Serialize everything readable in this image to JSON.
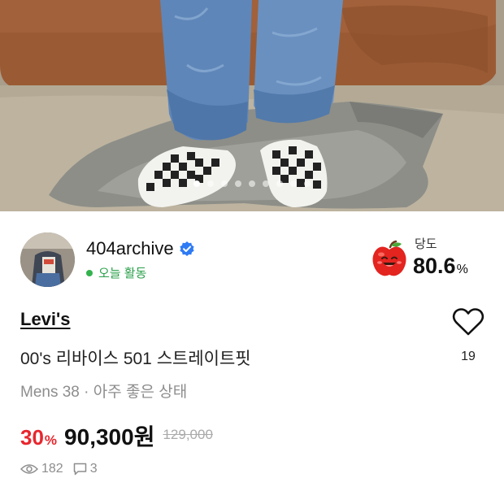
{
  "hero": {
    "image_description_icon": "product-photo-jeans-checkered-slip-ons",
    "pagination_count": 9,
    "pagination_active_index": 0
  },
  "seller": {
    "name": "404archive",
    "verified": true,
    "status": "오늘 활동",
    "status_color": "#33b24e"
  },
  "sweetness": {
    "label": "당도",
    "value": "80.6",
    "unit": "%",
    "icon": "apple-icon"
  },
  "product": {
    "brand": "Levi's",
    "title": "00's 리바이스 501 스트레이트핏",
    "meta": "Mens 38 · 아주 좋은 상태"
  },
  "like": {
    "count": "19",
    "icon": "heart-icon"
  },
  "price": {
    "discount": "30",
    "discount_unit": "%",
    "current": "90,300원",
    "original": "129,000",
    "discount_color": "#e8262e"
  },
  "stats": {
    "views": "182",
    "comments": "3"
  }
}
